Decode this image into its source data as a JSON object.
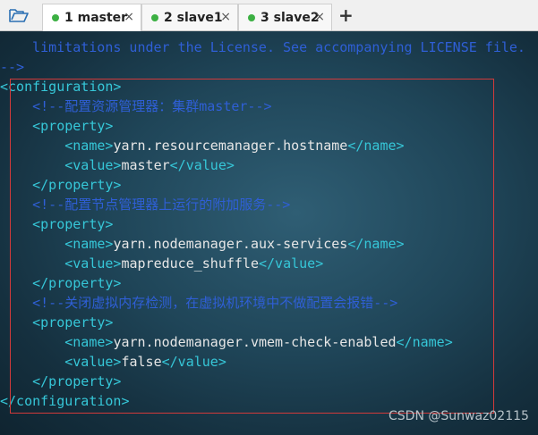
{
  "tabs": [
    {
      "label": "1 master",
      "close": "×"
    },
    {
      "label": "2 slave1",
      "close": "×"
    },
    {
      "label": "3 slave2",
      "close": "×"
    }
  ],
  "new_tab": "+",
  "colors": {
    "status_dot": "#3cb043",
    "comment": "#2f5fd6",
    "tag": "#36c7d8",
    "text": "#e6e6e6",
    "highlight_border": "#d23a3a"
  },
  "code": {
    "l0": {
      "text": "  limitations under the License. See accompanying LICENSE file."
    },
    "l1": {
      "text": "-->"
    },
    "l2": {
      "open": "<configuration>"
    },
    "l3": {
      "comment": "    <!--配置资源管理器：集群master-->"
    },
    "l4": {
      "open": "    <property>"
    },
    "l5": {
      "open": "        <name>",
      "value": "yarn.resourcemanager.hostname",
      "close": "</name>"
    },
    "l6": {
      "open": "        <value>",
      "value": "master",
      "close": "</value>"
    },
    "l7": {
      "close": "    </property>"
    },
    "l8": {
      "comment": "    <!--配置节点管理器上运行的附加服务-->"
    },
    "l9": {
      "open": "    <property>"
    },
    "l10": {
      "open": "        <name>",
      "value": "yarn.nodemanager.aux-services",
      "close": "</name>"
    },
    "l11": {
      "open": "        <value>",
      "value": "mapreduce_shuffle",
      "close": "</value>"
    },
    "l12": {
      "close": "    </property>"
    },
    "l13": {
      "comment": "    <!--关闭虚拟内存检测，在虚拟机环境中不做配置会报错-->"
    },
    "l14": {
      "open": "    <property>"
    },
    "l15": {
      "open": "        <name>",
      "value": "yarn.nodemanager.vmem-check-enabled",
      "close": "</name>"
    },
    "l16": {
      "open": "        <value>",
      "value": "false",
      "close": "</value>"
    },
    "l17": {
      "close": "    </property>"
    },
    "l18": {
      "close": "</configuration>"
    }
  },
  "watermark": "CSDN @Sunwaz02115"
}
